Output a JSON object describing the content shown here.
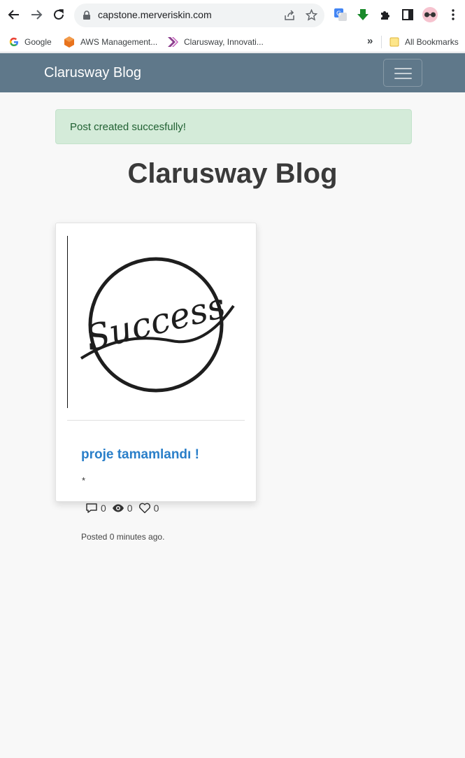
{
  "browser": {
    "url": "capstone.merveriskin.com",
    "bookmarks": [
      {
        "label": "Google",
        "icon": "google-icon"
      },
      {
        "label": "AWS Management...",
        "icon": "aws-icon"
      },
      {
        "label": "Clarusway, Innovati...",
        "icon": "clarusway-icon"
      }
    ],
    "more_bookmarks": "»",
    "all_bookmarks": "All Bookmarks"
  },
  "navbar": {
    "brand": "Clarusway Blog",
    "color": "#5f788a"
  },
  "alert": {
    "message": "Post created succesfully!"
  },
  "page": {
    "title": "Clarusway Blog"
  },
  "post": {
    "title": "proje tamamlandı !",
    "content": "*",
    "image_text": "Success",
    "comments": "0",
    "views": "0",
    "likes": "0",
    "posted": "Posted 0 minutes ago."
  },
  "colors": {
    "link": "#2a7fc9",
    "alert_bg": "#d4ebd9",
    "alert_text": "#216133"
  }
}
